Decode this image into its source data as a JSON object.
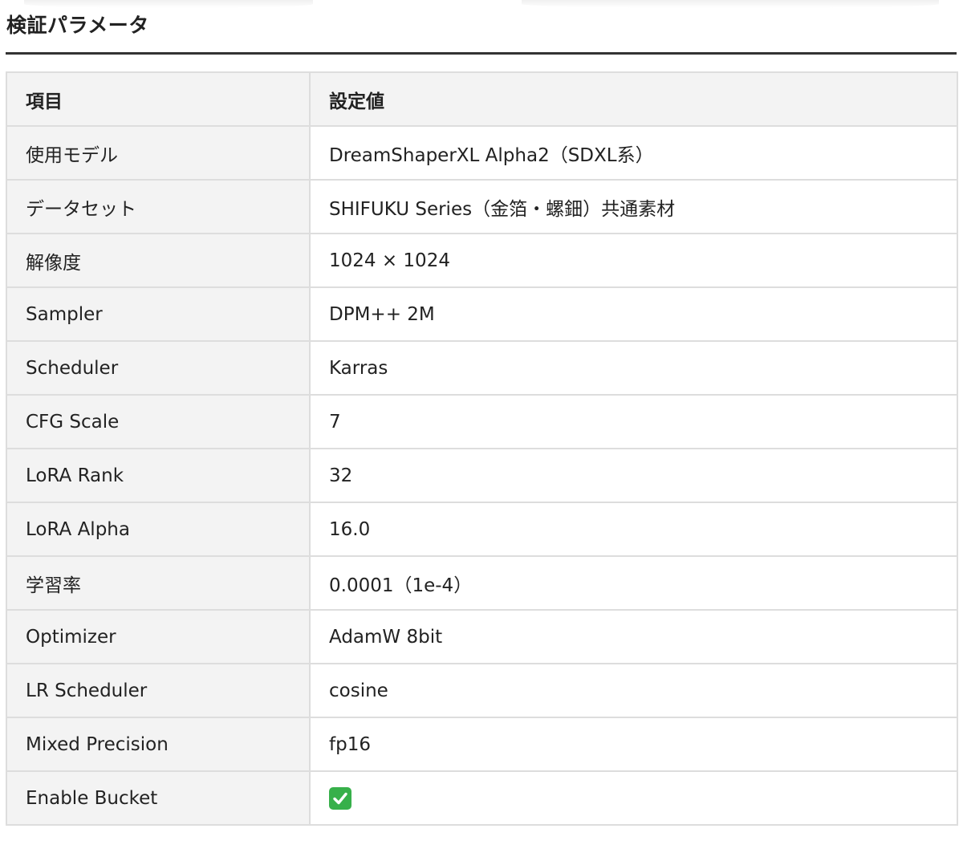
{
  "heading": "検証パラメータ",
  "table": {
    "headers": [
      "項目",
      "設定値"
    ],
    "rows": [
      {
        "key": "使用モデル",
        "value": "DreamShaperXL Alpha2（SDXL系）"
      },
      {
        "key": "データセット",
        "value": "SHIFUKU Series（金箔・螺鈿）共通素材"
      },
      {
        "key": "解像度",
        "value": "1024 × 1024"
      },
      {
        "key": "Sampler",
        "value": "DPM++ 2M"
      },
      {
        "key": "Scheduler",
        "value": "Karras"
      },
      {
        "key": "CFG Scale",
        "value": "7"
      },
      {
        "key": "LoRA Rank",
        "value": "32"
      },
      {
        "key": "LoRA Alpha",
        "value": "16.0"
      },
      {
        "key": "学習率",
        "value": "0.0001（1e-4）"
      },
      {
        "key": "Optimizer",
        "value": "AdamW 8bit"
      },
      {
        "key": "LR Scheduler",
        "value": "cosine"
      },
      {
        "key": "Mixed Precision",
        "value": "fp16"
      },
      {
        "key": "Enable Bucket",
        "value": "",
        "icon": "check-mark-icon",
        "icon_color": "#37b04a"
      }
    ]
  }
}
